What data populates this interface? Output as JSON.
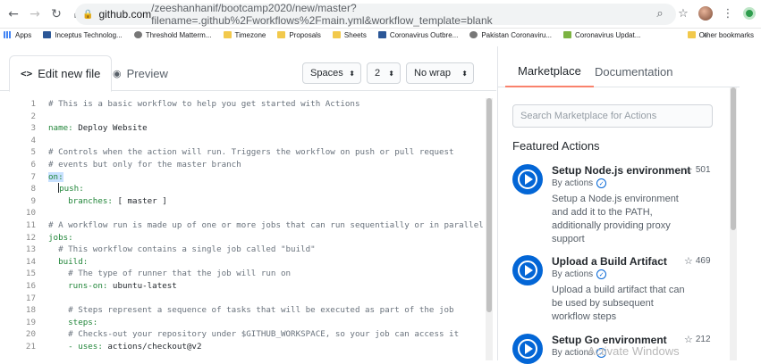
{
  "browser": {
    "url_host": "github.com",
    "url_path": "/zeeshanhanif/bootcamp2020/new/master?filename=.github%2Fworkflows%2Fmain.yml&workflow_template=blank",
    "bookmarks": [
      {
        "label": "Apps",
        "icon": "apps-icon"
      },
      {
        "label": "Inceptus Technolog...",
        "icon": "bookmark-icon"
      },
      {
        "label": "Threshold Matterm...",
        "icon": "bookmark-icon"
      },
      {
        "label": "Timezone",
        "icon": "folder-icon"
      },
      {
        "label": "Proposals",
        "icon": "folder-icon"
      },
      {
        "label": "Sheets",
        "icon": "folder-icon"
      },
      {
        "label": "Coronavirus Outbre...",
        "icon": "bookmark-icon"
      },
      {
        "label": "Pakistan Coronaviru...",
        "icon": "bookmark-icon"
      },
      {
        "label": "Coronavirus Updat...",
        "icon": "bookmark-icon"
      }
    ],
    "more_label": "»",
    "other_bookmarks": "Other bookmarks"
  },
  "editor": {
    "edit_tab": "Edit new file",
    "preview_tab": "Preview",
    "indent_mode": "Spaces",
    "indent_size": "2",
    "wrap_mode": "No wrap",
    "lines": [
      {
        "n": "1",
        "text": "# This is a basic workflow to help you get started with Actions",
        "kind": "comment"
      },
      {
        "n": "2",
        "text": "",
        "kind": "plain"
      },
      {
        "n": "3",
        "key": "name:",
        "value": " Deploy Website",
        "kind": "kv"
      },
      {
        "n": "4",
        "text": "",
        "kind": "plain"
      },
      {
        "n": "5",
        "text": "# Controls when the action will run. Triggers the workflow on push or pull request",
        "kind": "comment"
      },
      {
        "n": "6",
        "text": "# events but only for the master branch",
        "kind": "comment"
      },
      {
        "n": "7",
        "key": "on:",
        "value": "",
        "kind": "kv-hl"
      },
      {
        "n": "8",
        "text": "  push:",
        "kind": "cursor"
      },
      {
        "n": "9",
        "key": "    branches:",
        "value": " [ master ]",
        "kind": "kv"
      },
      {
        "n": "10",
        "text": "",
        "kind": "plain"
      },
      {
        "n": "11",
        "text": "# A workflow run is made up of one or more jobs that can run sequentially or in parallel",
        "kind": "comment"
      },
      {
        "n": "12",
        "key": "jobs:",
        "value": "",
        "kind": "kv"
      },
      {
        "n": "13",
        "text": "  # This workflow contains a single job called \"build\"",
        "kind": "comment"
      },
      {
        "n": "14",
        "key": "  build:",
        "value": "",
        "kind": "kv"
      },
      {
        "n": "15",
        "text": "    # The type of runner that the job will run on",
        "kind": "comment"
      },
      {
        "n": "16",
        "key": "    runs-on:",
        "value": " ubuntu-latest",
        "kind": "kv"
      },
      {
        "n": "17",
        "text": "",
        "kind": "plain"
      },
      {
        "n": "18",
        "text": "    # Steps represent a sequence of tasks that will be executed as part of the job",
        "kind": "comment"
      },
      {
        "n": "19",
        "key": "    steps:",
        "value": "",
        "kind": "kv"
      },
      {
        "n": "20",
        "text": "    # Checks-out your repository under $GITHUB_WORKSPACE, so your job can access it",
        "kind": "comment"
      },
      {
        "n": "21",
        "key": "    - uses:",
        "value": " actions/checkout@v2",
        "kind": "kv"
      }
    ]
  },
  "sidebar": {
    "marketplace_tab": "Marketplace",
    "documentation_tab": "Documentation",
    "search_placeholder": "Search Marketplace for Actions",
    "featured_heading": "Featured Actions",
    "actions": [
      {
        "title": "Setup Node.js environment",
        "by": "By actions",
        "stars": "501",
        "desc": "Setup a Node.js environment and add it to the PATH, additionally providing proxy support"
      },
      {
        "title": "Upload a Build Artifact",
        "by": "By actions",
        "stars": "469",
        "desc": "Upload a build artifact that can be used by subsequent workflow steps"
      },
      {
        "title": "Setup Go environment",
        "by": "By actions",
        "stars": "212",
        "desc": ""
      }
    ],
    "watermark": "Activate Windows"
  }
}
